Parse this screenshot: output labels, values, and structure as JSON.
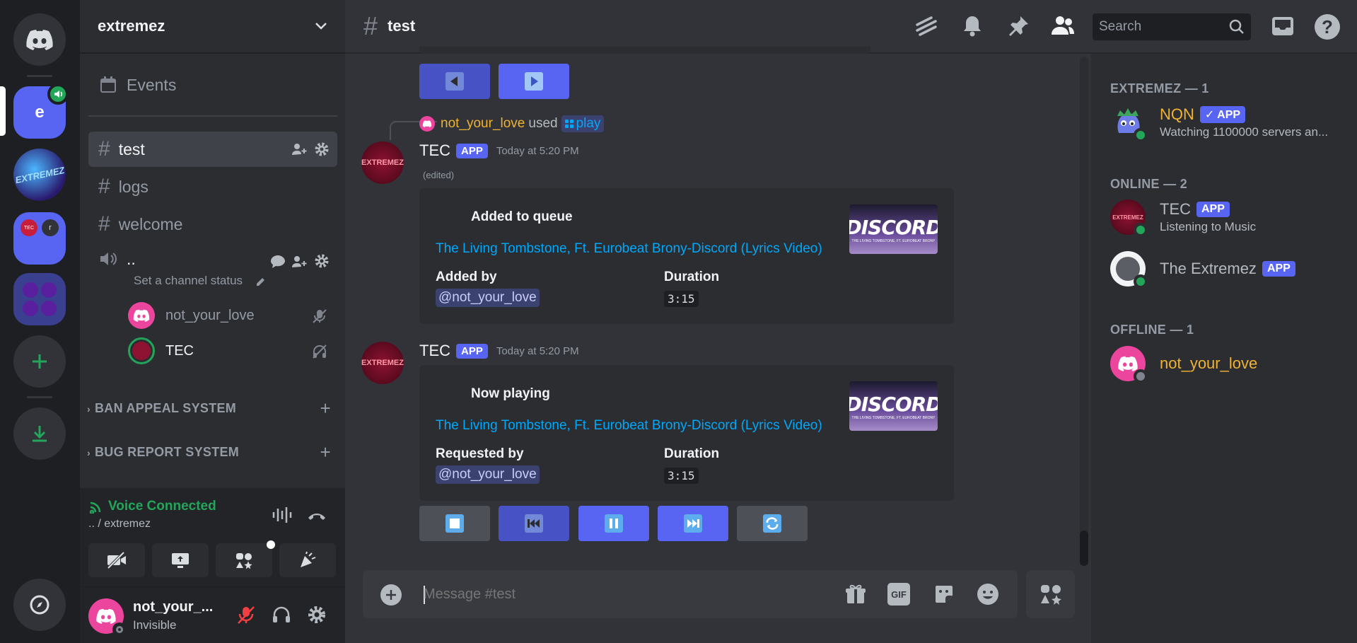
{
  "guild": {
    "name": "extremez"
  },
  "rail": {
    "guild_letter": "e"
  },
  "channels": {
    "events_label": "Events",
    "text": [
      {
        "label": "test"
      },
      {
        "label": "logs"
      },
      {
        "label": "welcome"
      }
    ],
    "voice": {
      "label": "..",
      "status_placeholder": "Set a channel status",
      "users": [
        {
          "name": "not_your_love"
        },
        {
          "name": "TEC"
        }
      ]
    },
    "categories": [
      {
        "label": "BAN APPEAL SYSTEM"
      },
      {
        "label": "BUG REPORT SYSTEM"
      }
    ]
  },
  "voice_status": {
    "title": "Voice Connected",
    "location": ".. / extremez"
  },
  "user": {
    "name": "not_your_...",
    "status": "Invisible"
  },
  "header": {
    "channel": "test",
    "search_placeholder": "Search"
  },
  "interaction": {
    "user": "not_your_love",
    "used": "used",
    "command": "play"
  },
  "messages": [
    {
      "author": "TEC",
      "badge": "APP",
      "time": "Today at 5:20 PM",
      "edited": "(edited)",
      "embed": {
        "title": "Added to queue",
        "link": "The Living Tombstone, Ft. Eurobeat Brony-Discord (Lyrics Video)",
        "field1_label": "Added by",
        "field1_value": "@not_your_love",
        "field2_label": "Duration",
        "field2_value": "3:15",
        "thumb_title": "DISCORD",
        "thumb_sub": "THE LIVING TOMBSTONE, FT. EUROBEAT BRONY"
      }
    },
    {
      "author": "TEC",
      "badge": "APP",
      "time": "Today at 5:20 PM",
      "embed": {
        "title": "Now playing",
        "link": "The Living Tombstone, Ft. Eurobeat Brony-Discord (Lyrics Video)",
        "field1_label": "Requested by",
        "field1_value": "@not_your_love",
        "field2_label": "Duration",
        "field2_value": "3:15",
        "thumb_title": "DISCORD",
        "thumb_sub": "THE LIVING TOMBSTONE, FT. EUROBEAT BRONY"
      }
    }
  ],
  "composer": {
    "placeholder": "Message #test"
  },
  "members": {
    "groups": [
      {
        "heading": "EXTREMEZ — 1",
        "items": [
          {
            "name": "NQN",
            "badge": "✓ APP",
            "sub": "Watching 1100000 servers an..."
          }
        ]
      },
      {
        "heading": "ONLINE — 2",
        "items": [
          {
            "name": "TEC",
            "badge": "APP",
            "sub": "Listening to Music"
          },
          {
            "name": "The Extremez",
            "badge": "APP",
            "sub": ""
          }
        ]
      },
      {
        "heading": "OFFLINE — 1",
        "items": [
          {
            "name": "not_your_love",
            "sub": ""
          }
        ]
      }
    ]
  },
  "colors": {
    "blurple": "#5865f2",
    "green": "#23a55a",
    "gold": "#f0b232",
    "link": "#00a8fc"
  }
}
